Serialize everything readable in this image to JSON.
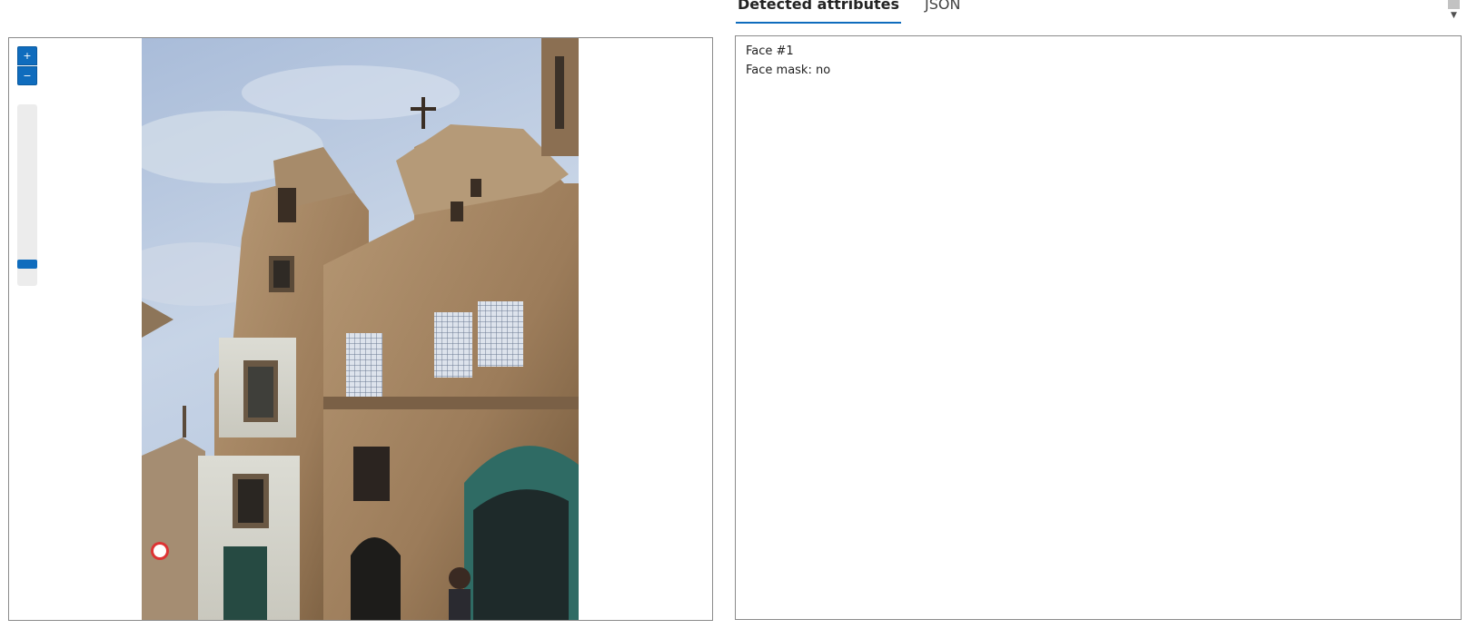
{
  "viewer": {
    "zoom_in_icon": "plus-icon",
    "zoom_out_icon": "minus-icon",
    "zoom_level_fraction": 0.9,
    "image_alt": "Baroque church facade"
  },
  "tabs": [
    {
      "label": "Detected attributes",
      "active": true
    },
    {
      "label": "JSON",
      "active": false
    }
  ],
  "results": {
    "lines": [
      "Face #1",
      "Face mask: no"
    ]
  },
  "scroll": {
    "down_icon": "chevron-down-icon"
  },
  "colors": {
    "accent": "#0f6cbd",
    "border": "#8a8a8a",
    "track": "#ececec"
  }
}
